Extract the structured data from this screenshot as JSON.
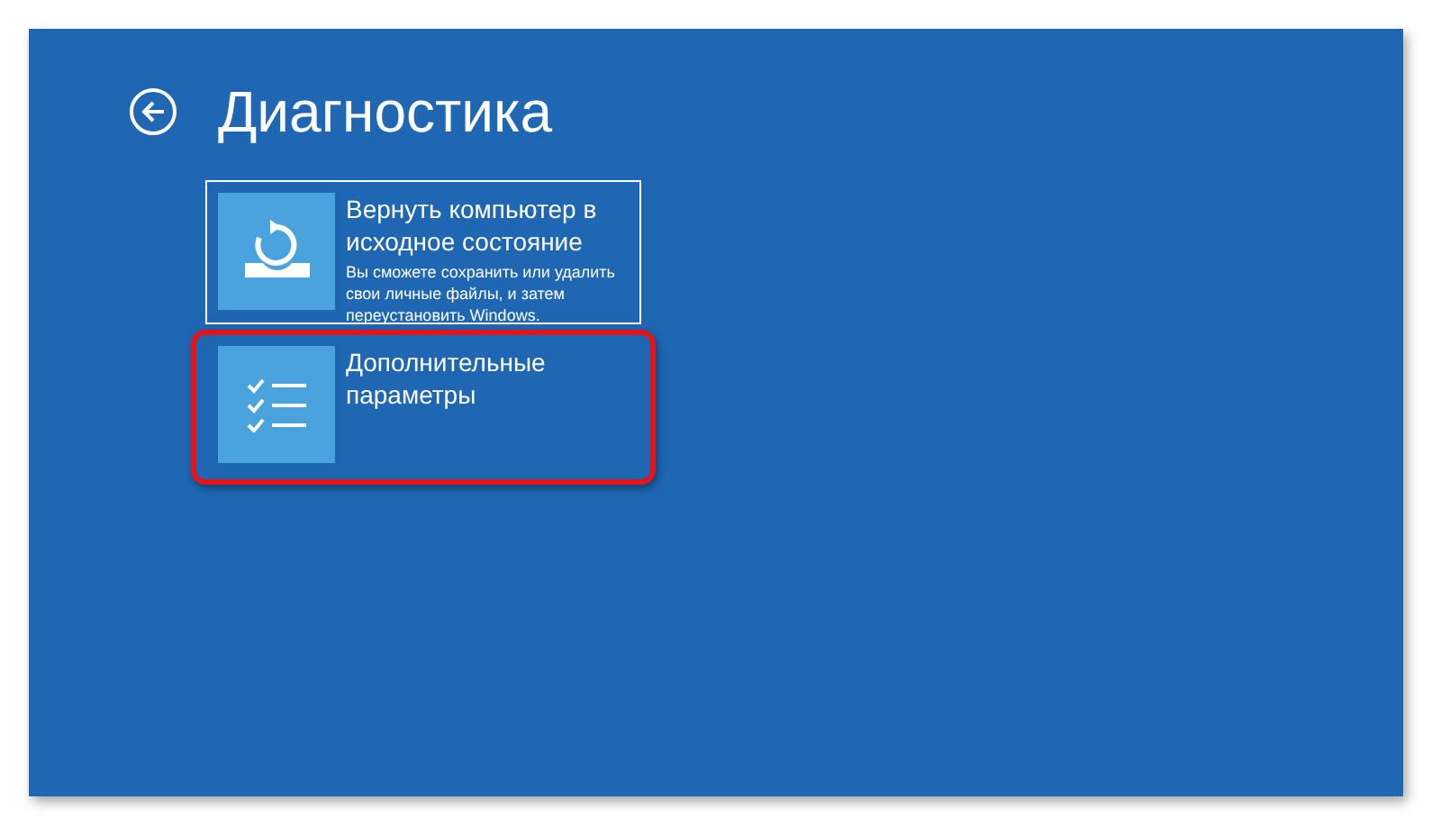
{
  "title": "Диагностика",
  "options": [
    {
      "kind": "reset",
      "title": "Вернуть компьютер в исходное состояние",
      "description": "Вы сможете сохранить или удалить свои личные файлы, и затем переустановить Windows.",
      "selected": true,
      "highlighted": false
    },
    {
      "kind": "advanced",
      "title": "Дополнительные параметры",
      "selected": false,
      "highlighted": true
    }
  ]
}
